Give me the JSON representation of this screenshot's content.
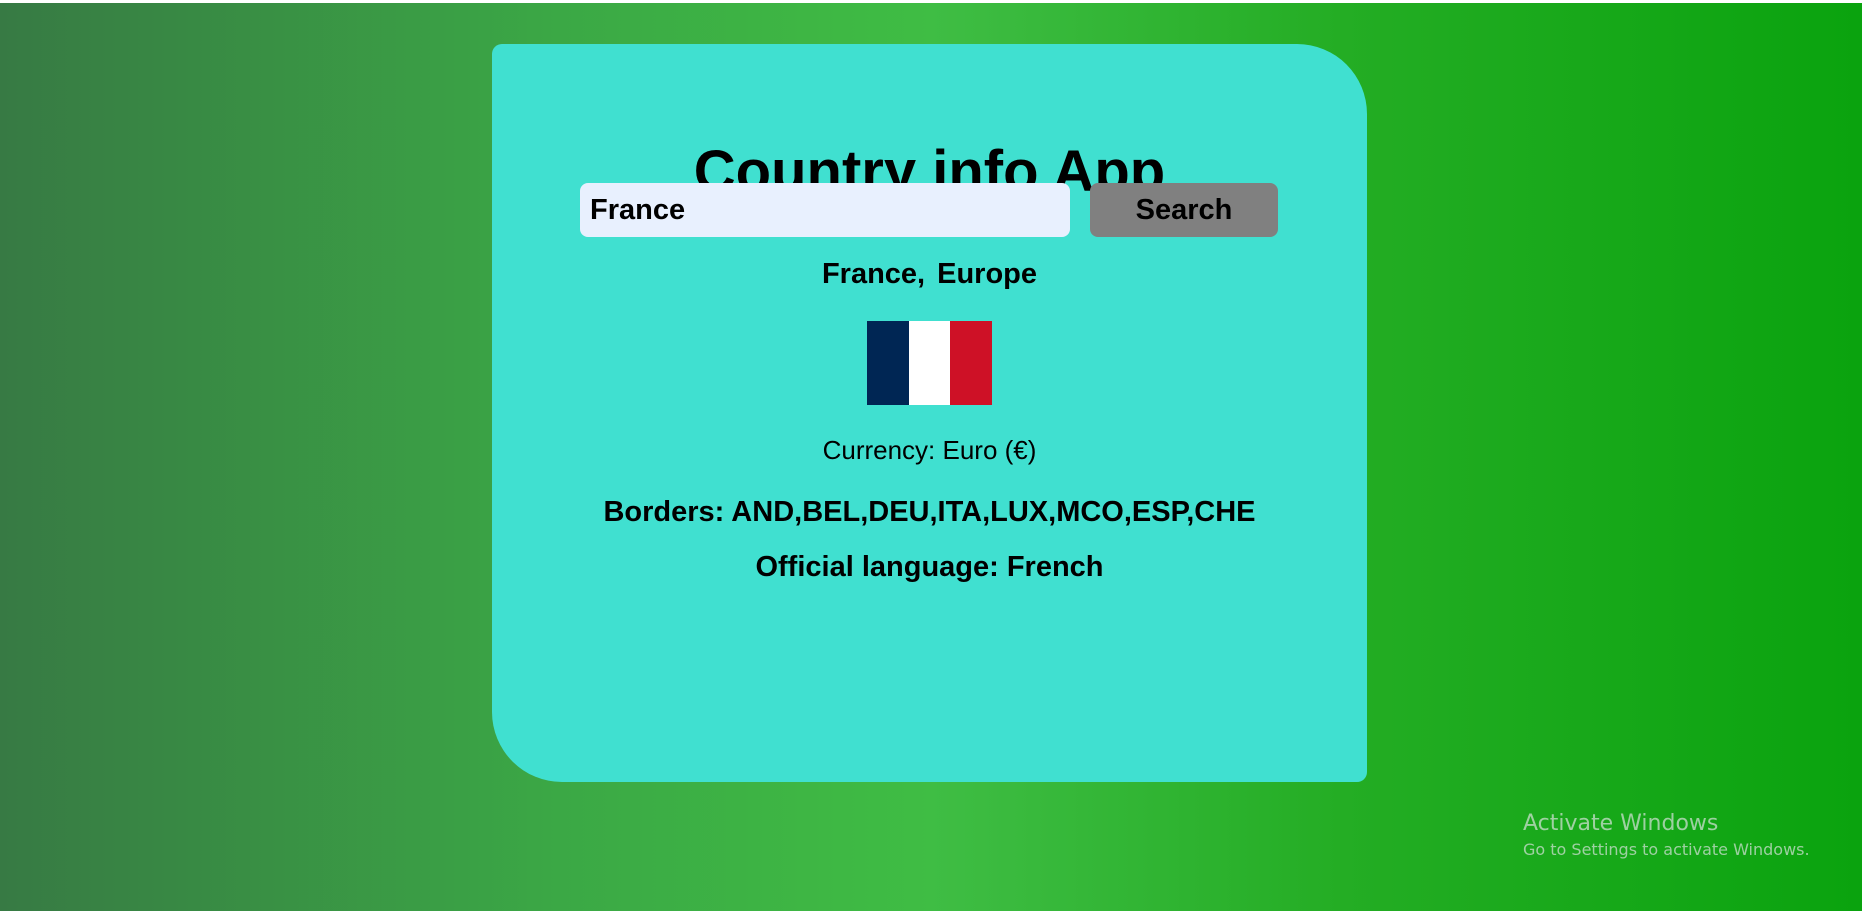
{
  "app": {
    "title": "Country info App"
  },
  "search": {
    "value": "France",
    "button_label": "Search"
  },
  "result": {
    "country": "France,",
    "region": "Europe",
    "flag": {
      "colors": [
        "#002654",
        "#ffffff",
        "#ce1126"
      ]
    },
    "currency": "Currency: Euro (€)",
    "borders": "Borders: AND,BEL,DEU,ITA,LUX,MCO,ESP,CHE",
    "language": "Official language: French"
  },
  "watermark": {
    "title": "Activate Windows",
    "subtitle": "Go to Settings to activate Windows."
  },
  "colors": {
    "card": "#40e0d0",
    "button": "#808080",
    "input": "#e8f0fe"
  }
}
